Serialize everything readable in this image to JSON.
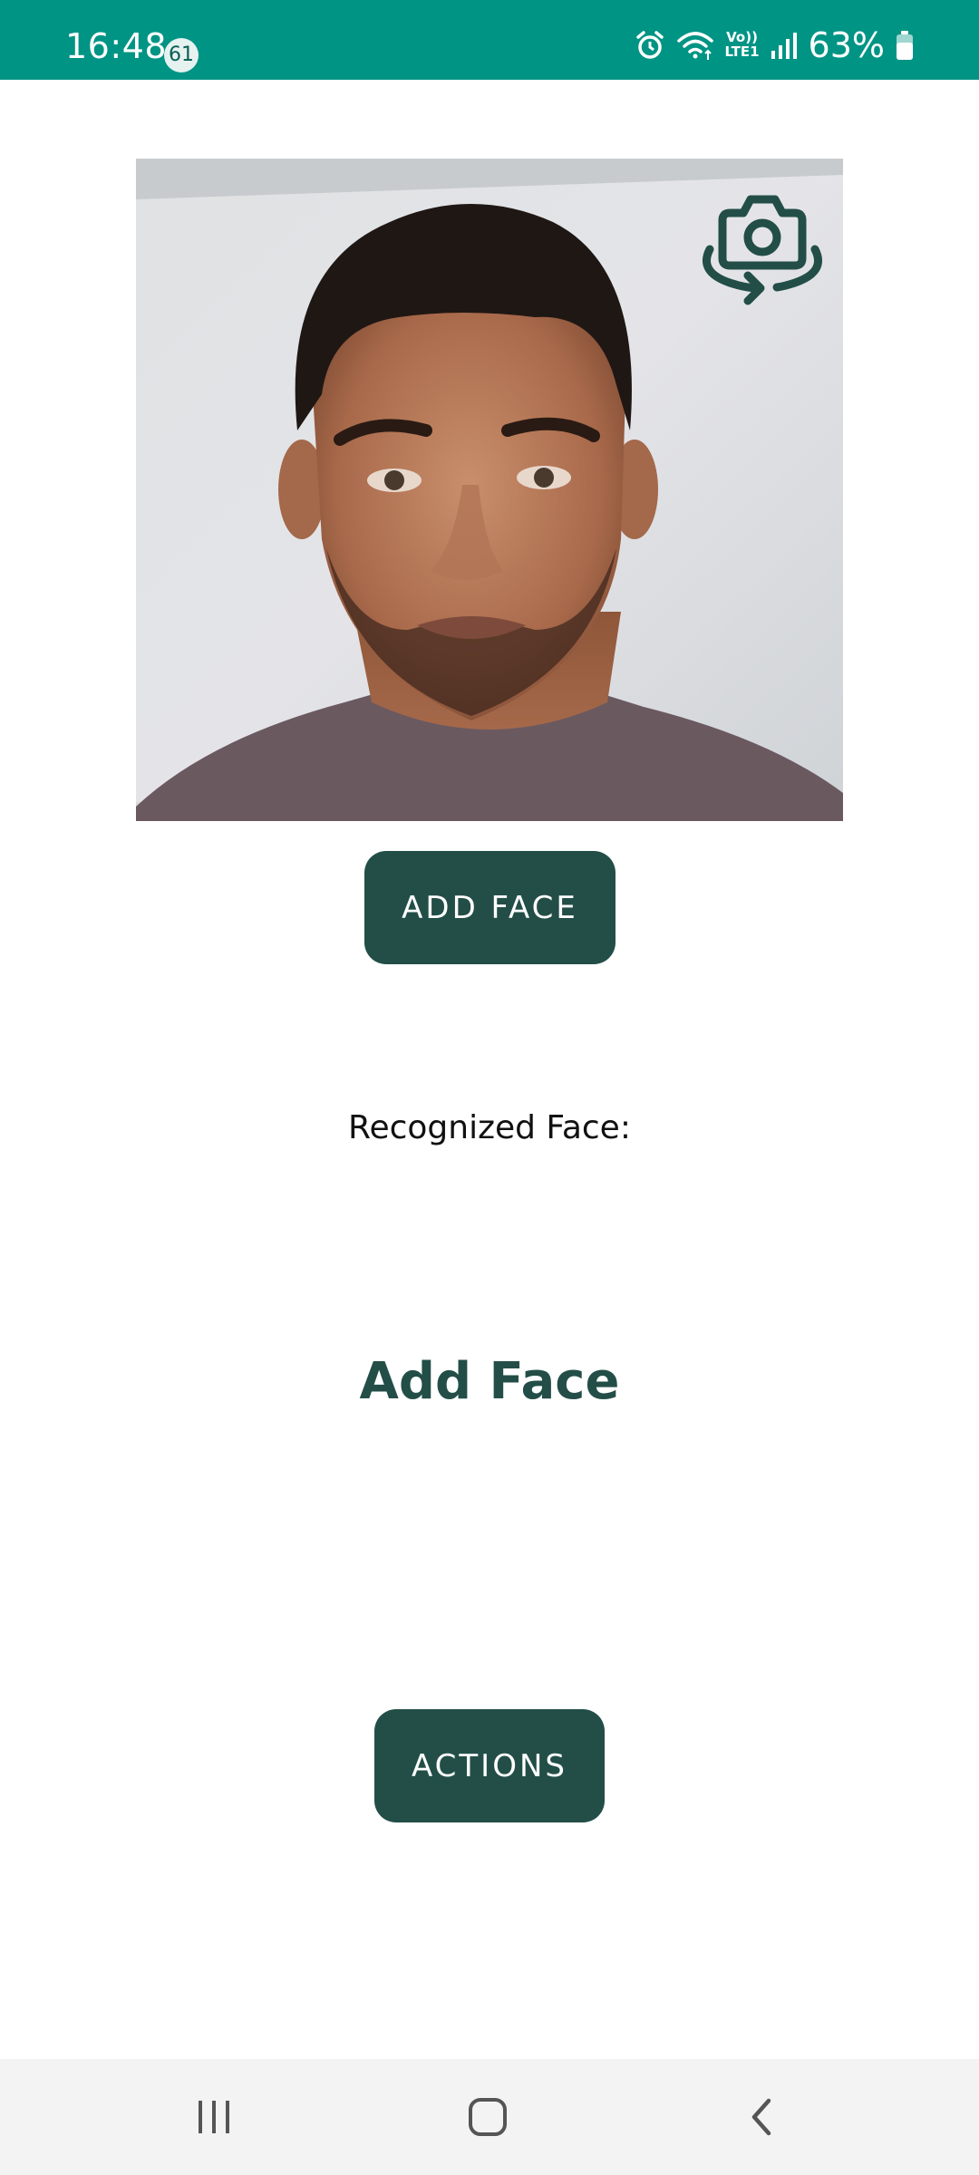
{
  "status_bar": {
    "time": "16:48",
    "notification_count": "61",
    "network_label_top": "Vo))",
    "network_label_bottom": "LTE1",
    "battery_percent": "63%",
    "icons": [
      "alarm-icon",
      "wifi-icon",
      "volte-icon",
      "signal-icon",
      "battery-icon"
    ]
  },
  "camera": {
    "switch_icon": "switch-camera-icon"
  },
  "buttons": {
    "add_face": "ADD FACE",
    "actions": "ACTIONS"
  },
  "recognition": {
    "label": "Recognized Face:",
    "value": "Add Face"
  },
  "nav_bar": {
    "icons": [
      "recents-icon",
      "home-icon",
      "back-icon"
    ]
  },
  "colors": {
    "status_bar": "#009485",
    "accent": "#234e48",
    "background": "#ffffff",
    "nav_bar": "#f3f3f3"
  }
}
